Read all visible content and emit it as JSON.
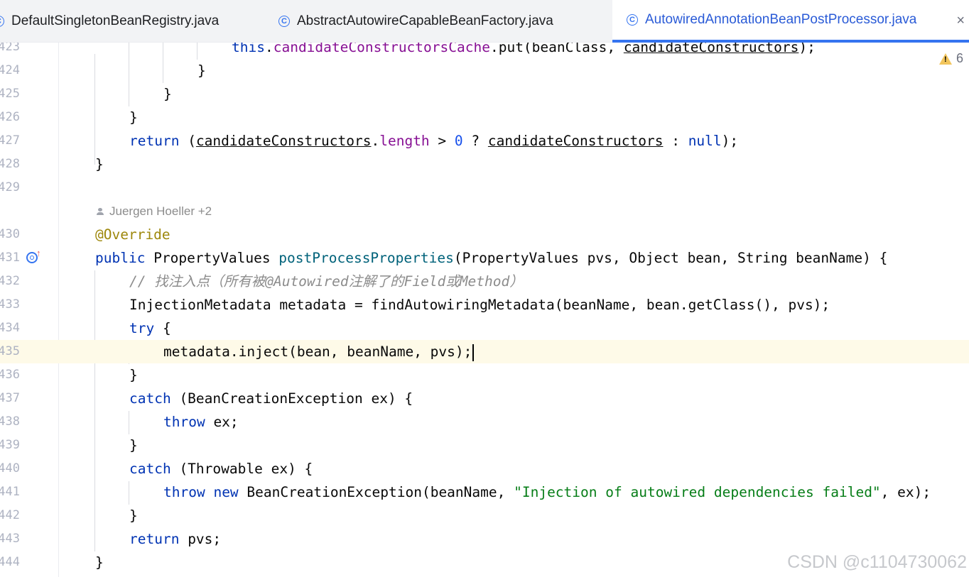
{
  "tabs": [
    {
      "label": "DefaultSingletonBeanRegistry.java"
    },
    {
      "label": "AbstractAutowireCapableBeanFactory.java"
    },
    {
      "label": "AutowiredAnnotationBeanPostProcessor.java",
      "close": "×"
    }
  ],
  "inspection": {
    "warnings": "6",
    "icon": "warning-icon",
    "color": "#f2c55c"
  },
  "author_hint": "Juergen Hoeller +2",
  "lines": [
    {
      "n": "423"
    },
    {
      "n": "424"
    },
    {
      "n": "425"
    },
    {
      "n": "426"
    },
    {
      "n": "427"
    },
    {
      "n": "428"
    },
    {
      "n": "429"
    },
    {
      "n": "430"
    },
    {
      "n": "431"
    },
    {
      "n": "432"
    },
    {
      "n": "433"
    },
    {
      "n": "434"
    },
    {
      "n": "435"
    },
    {
      "n": "436"
    },
    {
      "n": "437"
    },
    {
      "n": "438"
    },
    {
      "n": "439"
    },
    {
      "n": "440"
    },
    {
      "n": "441"
    },
    {
      "n": "442"
    },
    {
      "n": "443"
    },
    {
      "n": "444"
    }
  ],
  "code": {
    "l423": [
      "this",
      ".",
      "candidateConstructorsCache",
      ".put(beanClass, ",
      "candidateConstructors",
      ");"
    ],
    "l424": "}",
    "l425": "}",
    "l426": "}",
    "l427": [
      "return",
      " (",
      "candidateConstructors",
      ".",
      "length",
      " > ",
      "0",
      " ? ",
      "candidateConstructors",
      " : ",
      "null",
      ");"
    ],
    "l428": "}",
    "l430": "@Override",
    "l431": [
      "public",
      " PropertyValues ",
      "postProcessProperties",
      "(PropertyValues pvs, Object bean, String beanName) {"
    ],
    "l432": "// 找注入点（所有被@Autowired注解了的Field或Method）",
    "l433": "InjectionMetadata metadata = findAutowiringMetadata(beanName, bean.getClass(), pvs);",
    "l434": [
      "try",
      " {"
    ],
    "l435": "metadata.inject(bean, beanName, pvs);",
    "l436": "}",
    "l437": [
      "catch",
      " (BeanCreationException ex) {"
    ],
    "l438": [
      "throw",
      " ex;"
    ],
    "l439": "}",
    "l440": [
      "catch",
      " (Throwable ex) {"
    ],
    "l441": [
      "throw",
      " ",
      "new",
      " BeanCreationException(beanName, ",
      "\"Injection of autowired dependencies failed\"",
      ", ex);"
    ],
    "l442": "}",
    "l443": [
      "return",
      " pvs;"
    ],
    "l444": "}"
  },
  "gutter_icon": "implements-method-icon",
  "current_line": "435",
  "watermark": "CSDN @c1104730062"
}
